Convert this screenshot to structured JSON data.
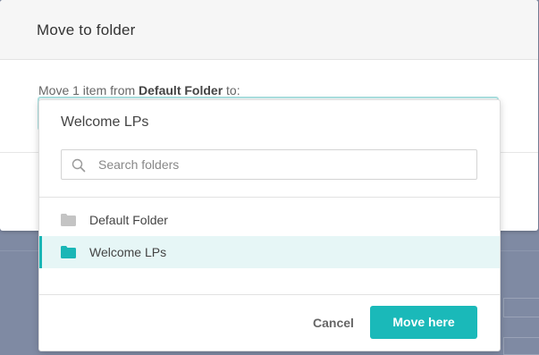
{
  "modal": {
    "title": "Move to folder",
    "desc_prefix": "Move 1 item from ",
    "source_folder": "Default Folder",
    "desc_suffix": " to:"
  },
  "dropdown": {
    "selected_value": "Welcome LPs",
    "search": {
      "placeholder": "Search folders",
      "value": ""
    },
    "folders": [
      {
        "label": "Default Folder",
        "selected": false,
        "icon": "folder-icon",
        "color": "#c4c4c4"
      },
      {
        "label": "Welcome LPs",
        "selected": true,
        "icon": "folder-icon",
        "color": "#1ab6b6"
      }
    ]
  },
  "footer": {
    "cancel_label": "Cancel",
    "move_label": "Move here"
  },
  "colors": {
    "accent": "#1ab9b9",
    "selected_row": "#e6f6f6",
    "overlay": "#7f8aa3"
  }
}
